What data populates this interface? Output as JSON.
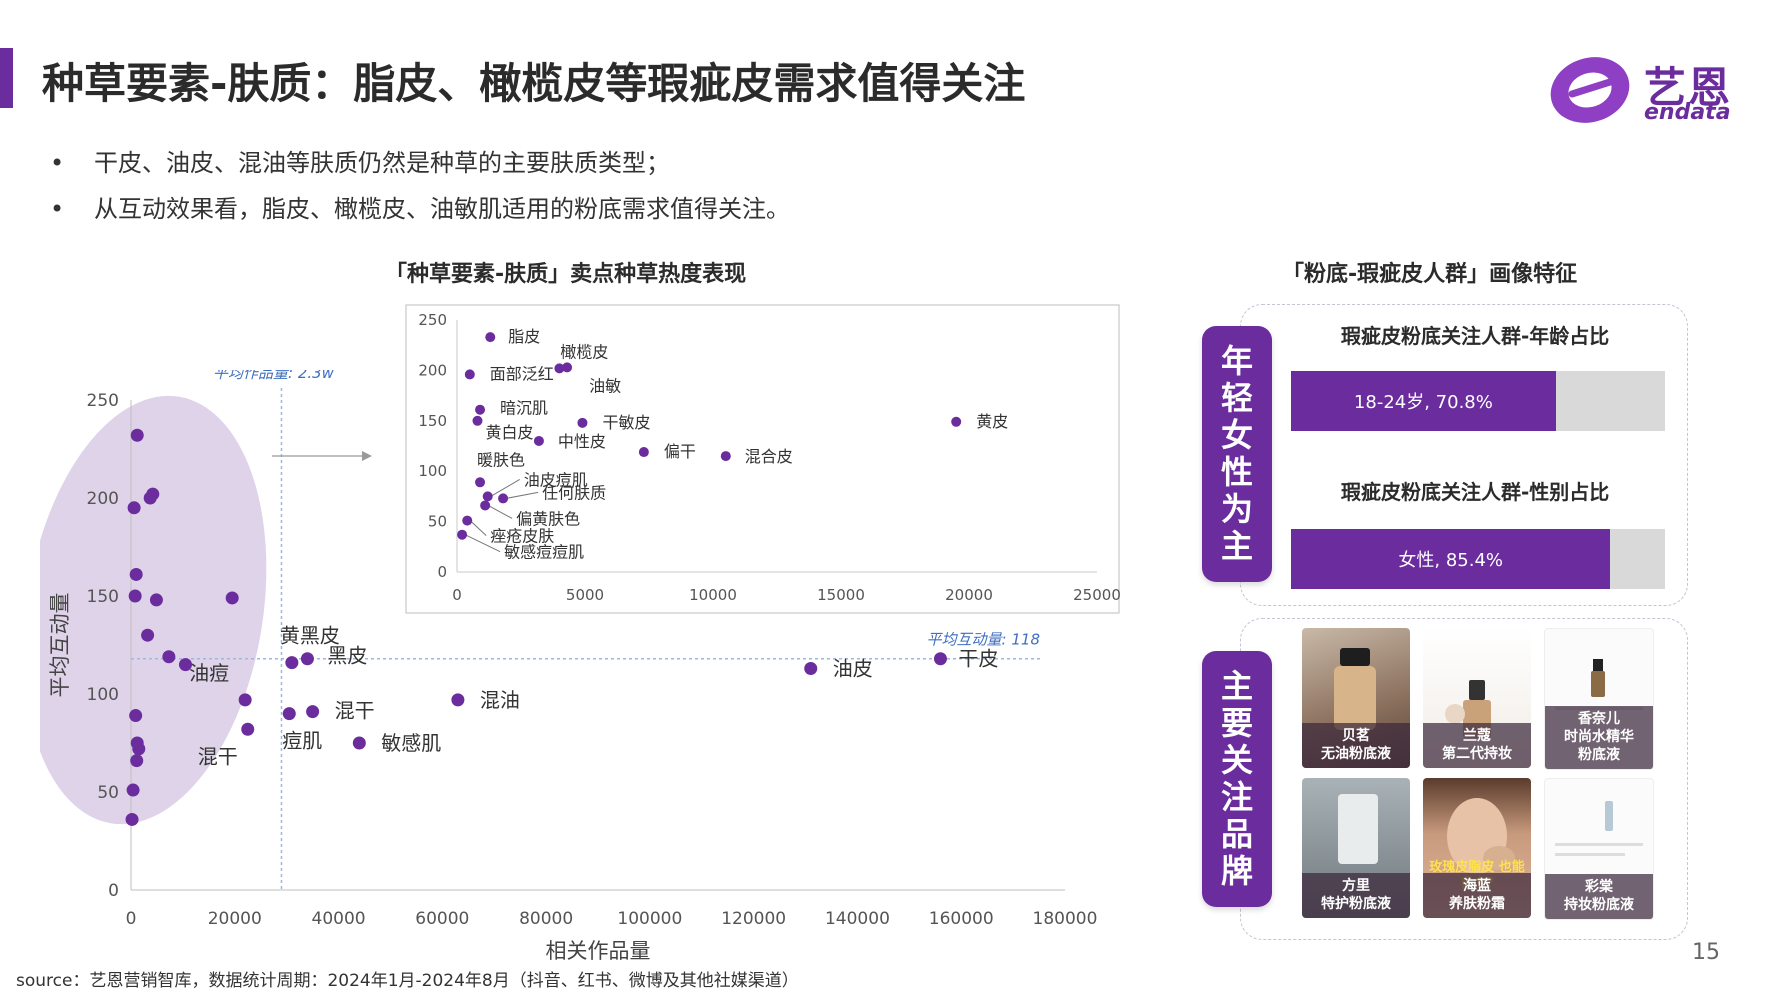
{
  "title": "种草要素-肤质：脂皮、橄榄皮等瑕疵皮需求值得关注",
  "logo": {
    "cn": "艺恩",
    "en": "endata"
  },
  "bullets": [
    "干皮、油皮、混油等肤质仍然是种草的主要肤质类型；",
    "从互动效果看，脂皮、橄榄皮、油敏肌适用的粉底需求值得关注。"
  ],
  "left_chart_title": "「种草要素-肤质」卖点种草热度表现",
  "right_panel_title": "「粉底-瑕疵皮人群」画像特征",
  "panel1": {
    "vertical_label": "年轻女性为主",
    "age_title": "瑕疵皮粉底关注人群-年龄占比",
    "age_bar": {
      "label": "18-24岁, 70.8%",
      "value": 70.8
    },
    "gender_title": "瑕疵皮粉底关注人群-性别占比",
    "gender_bar": {
      "label": "女性, 85.4%",
      "value": 85.4
    }
  },
  "panel2": {
    "vertical_label": "主要关注品牌",
    "brands": [
      {
        "line1": "贝茗",
        "line2": "无油粉底液"
      },
      {
        "line1": "兰蔻",
        "line2": "第二代持妆"
      },
      {
        "line1": "香奈儿",
        "line2": "时尚水精华",
        "line3": "粉底液"
      },
      {
        "line1": "方里",
        "line2": "特护粉底液"
      },
      {
        "line1": "海蓝",
        "line2": "养肤粉霜"
      },
      {
        "line1": "彩棠",
        "line2": "持妆粉底液"
      }
    ],
    "overlay_text": "玫瑰皮脂皮 也能 自由?"
  },
  "source": "source：艺恩营销智库，数据统计周期：2024年1月-2024年8月（抖音、红书、微博及其他社媒渠道）",
  "page_number": "15",
  "colors": {
    "accent": "#6B2C9E",
    "ellipse": "#D9CBE6",
    "refline": "#9DB8E0",
    "bar_track": "#d9d9d9"
  },
  "chart_data": [
    {
      "type": "scatter",
      "xlabel": "相关作品量",
      "ylabel": "平均互动量",
      "xlim": [
        0,
        180000
      ],
      "ylim": [
        0,
        250
      ],
      "xticks": [
        0,
        20000,
        40000,
        60000,
        80000,
        100000,
        120000,
        140000,
        160000,
        180000
      ],
      "yticks": [
        0,
        50,
        100,
        150,
        200,
        250
      ],
      "ref_x": {
        "label": "平均作品量: 2.3w",
        "value": 29000
      },
      "ref_y": {
        "label": "平均互动量: 118",
        "value": 118
      },
      "points": [
        {
          "label": "干皮",
          "x": 156000,
          "y": 118
        },
        {
          "label": "油皮",
          "x": 131000,
          "y": 113
        },
        {
          "label": "混油",
          "x": 63000,
          "y": 97
        },
        {
          "label": "敏感肌",
          "x": 44000,
          "y": 75
        },
        {
          "label": "混干",
          "x": 35000,
          "y": 91
        },
        {
          "label": "痘肌",
          "x": 30500,
          "y": 90
        },
        {
          "label": "黑皮",
          "x": 34000,
          "y": 118
        },
        {
          "label": "黄黑皮",
          "x": 31000,
          "y": 116
        },
        {
          "label": "油痘",
          "x": 22000,
          "y": 97
        },
        {
          "label": "混干",
          "x": 22500,
          "y": 82
        },
        {
          "label": "",
          "x": 19500,
          "y": 149
        },
        {
          "label": "",
          "x": 1200,
          "y": 232
        },
        {
          "label": "",
          "x": 4200,
          "y": 202
        },
        {
          "label": "",
          "x": 3700,
          "y": 200
        },
        {
          "label": "",
          "x": 600,
          "y": 195
        },
        {
          "label": "",
          "x": 1000,
          "y": 161
        },
        {
          "label": "",
          "x": 800,
          "y": 150
        },
        {
          "label": "",
          "x": 4900,
          "y": 148
        },
        {
          "label": "",
          "x": 3200,
          "y": 130
        },
        {
          "label": "",
          "x": 7300,
          "y": 119
        },
        {
          "label": "",
          "x": 10500,
          "y": 115
        },
        {
          "label": "",
          "x": 900,
          "y": 89
        },
        {
          "label": "",
          "x": 1200,
          "y": 75
        },
        {
          "label": "",
          "x": 1500,
          "y": 72
        },
        {
          "label": "",
          "x": 1100,
          "y": 66
        },
        {
          "label": "",
          "x": 400,
          "y": 51
        },
        {
          "label": "",
          "x": 200,
          "y": 36
        }
      ]
    },
    {
      "type": "scatter",
      "xlim": [
        0,
        25000
      ],
      "ylim": [
        0,
        250
      ],
      "xticks": [
        0,
        5000,
        10000,
        15000,
        20000,
        25000
      ],
      "yticks": [
        0,
        50,
        100,
        150,
        200,
        250
      ],
      "points": [
        {
          "label": "脂皮",
          "x": 1300,
          "y": 233
        },
        {
          "label": "橄榄皮",
          "x": 4000,
          "y": 202
        },
        {
          "label": "油敏",
          "x": 4300,
          "y": 203
        },
        {
          "label": "面部泛红",
          "x": 500,
          "y": 196
        },
        {
          "label": "暗沉肌",
          "x": 900,
          "y": 161
        },
        {
          "label": "干敏皮",
          "x": 4900,
          "y": 148
        },
        {
          "label": "黄皮",
          "x": 19500,
          "y": 149
        },
        {
          "label": "黄白皮",
          "x": 800,
          "y": 150
        },
        {
          "label": "中性皮",
          "x": 3200,
          "y": 130
        },
        {
          "label": "偏干",
          "x": 7300,
          "y": 119
        },
        {
          "label": "混合皮",
          "x": 10500,
          "y": 115
        },
        {
          "label": "暖肤色",
          "x": 900,
          "y": 89
        },
        {
          "label": "油皮痘肌",
          "x": 1200,
          "y": 75
        },
        {
          "label": "任何肤质",
          "x": 1800,
          "y": 73
        },
        {
          "label": "偏黄肤色",
          "x": 1100,
          "y": 66
        },
        {
          "label": "痤疮皮肤",
          "x": 400,
          "y": 51
        },
        {
          "label": "敏感痘痘肌",
          "x": 200,
          "y": 37
        }
      ]
    }
  ]
}
